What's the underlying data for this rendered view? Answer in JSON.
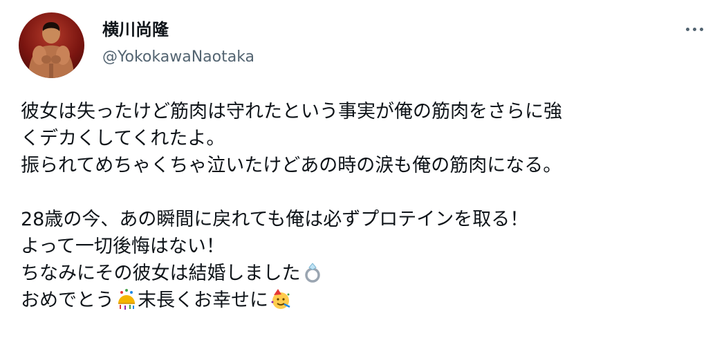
{
  "user": {
    "display_name": "横川尚隆",
    "handle": "@YokokawaNaotaka"
  },
  "tweet": {
    "lines": [
      "彼女は失ったけど筋肉は守れたという事実が俺の筋肉をさらに強",
      "くデカくしてくれたよ。",
      "振られてめちゃくちゃ泣いたけどあの時の涙も俺の筋肉になる。",
      "",
      "28歳の今、あの瞬間に戻れても俺は必ずプロテインを取る！",
      "よって一切後悔はない！",
      "ちなみにその彼女は結婚しました",
      "おめでとう",
      "末長くお幸せに"
    ],
    "emoji": {
      "ring": "ring-emoji",
      "confetti": "confetti-ball-emoji",
      "party_face": "partying-face-emoji"
    }
  },
  "icons": {
    "more": "more-icon"
  }
}
